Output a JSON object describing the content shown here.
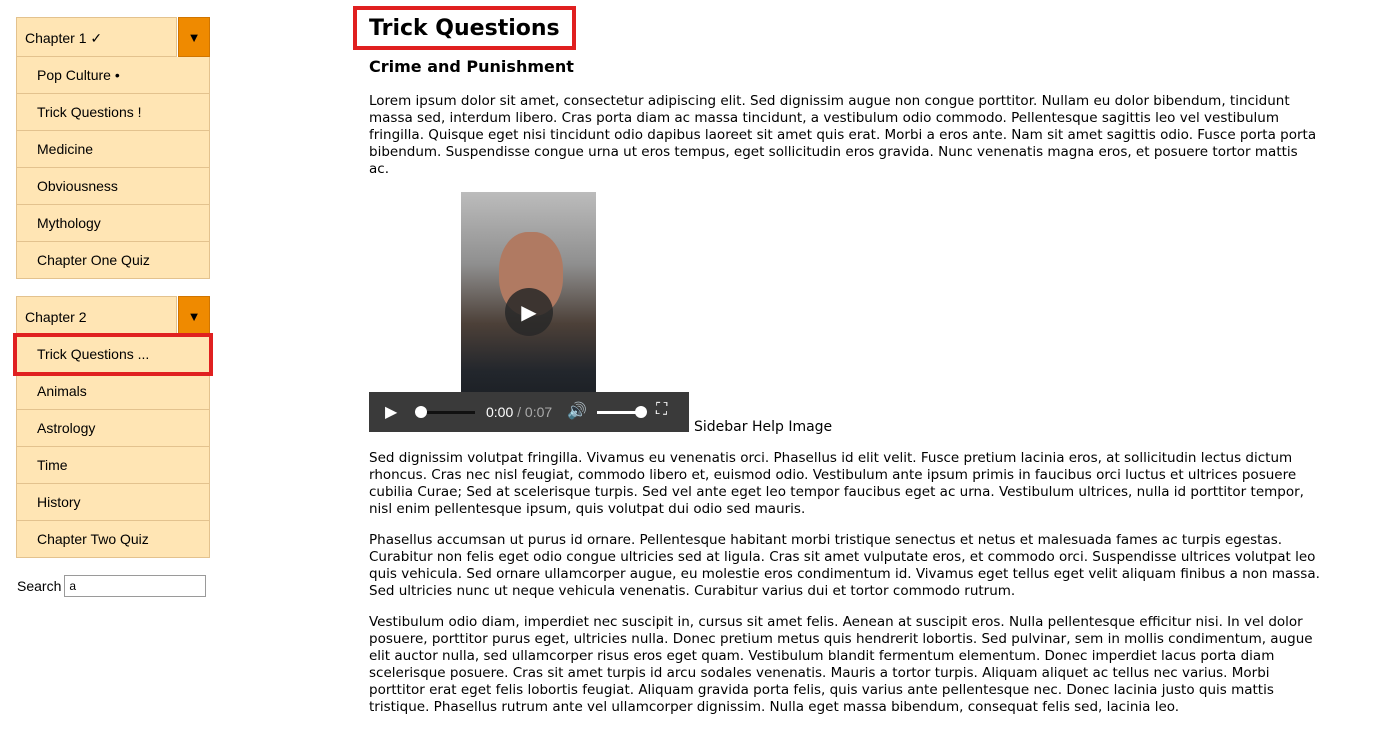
{
  "sidebar": {
    "chapters": [
      {
        "title": "Chapter 1 ✓",
        "toggle": "▼",
        "items": [
          "Pop Culture •",
          "Trick Questions !",
          "Medicine",
          "Obviousness",
          "Mythology",
          "Chapter One Quiz"
        ]
      },
      {
        "title": "Chapter 2",
        "toggle": "▼",
        "items": [
          "Trick Questions ...",
          "Animals",
          "Astrology",
          "Time",
          "History",
          "Chapter Two Quiz"
        ]
      }
    ],
    "search": {
      "label": "Search",
      "value": "a"
    }
  },
  "main": {
    "title": "Trick Questions",
    "subtitle": "Crime and Punishment",
    "paragraph1": "Lorem ipsum dolor sit amet, consectetur adipiscing elit. Sed dignissim augue non congue porttitor. Nullam eu dolor bibendum, tincidunt massa sed, interdum libero. Cras porta diam ac massa tincidunt, a vestibulum odio commodo. Pellentesque sagittis leo vel vestibulum fringilla. Quisque eget nisi tincidunt odio dapibus laoreet sit amet quis erat. Morbi a eros ante. Nam sit amet sagittis odio. Fusce porta porta bibendum. Suspendisse congue urna ut eros tempus, eget sollicitudin eros gravida. Nunc venenatis magna eros, et posuere tortor mattis ac.",
    "video": {
      "current_time": "0:00",
      "duration": "/ 0:07",
      "progress": 0,
      "volume": 1.0,
      "play_icon": "▶",
      "volume_icon": "🔊",
      "fullscreen_icon": "⛶"
    },
    "image_alt": "Sidebar Help Image",
    "paragraph2": "Sed dignissim volutpat fringilla. Vivamus eu venenatis orci. Phasellus id elit velit. Fusce pretium lacinia eros, at sollicitudin lectus dictum rhoncus. Cras nec nisl feugiat, commodo libero et, euismod odio. Vestibulum ante ipsum primis in faucibus orci luctus et ultrices posuere cubilia Curae; Sed at scelerisque turpis. Sed vel ante eget leo tempor faucibus eget ac urna. Vestibulum ultrices, nulla id porttitor tempor, nisl enim pellentesque ipsum, quis volutpat dui odio sed mauris.",
    "paragraph3": "Phasellus accumsan ut purus id ornare. Pellentesque habitant morbi tristique senectus et netus et malesuada fames ac turpis egestas. Curabitur non felis eget odio congue ultricies sed at ligula. Cras sit amet vulputate eros, et commodo orci. Suspendisse ultrices volutpat leo quis vehicula. Sed ornare ullamcorper augue, eu molestie eros condimentum id. Vivamus eget tellus eget velit aliquam finibus a non massa. Sed ultricies nunc ut neque vehicula venenatis. Curabitur varius dui et tortor commodo rutrum.",
    "paragraph4": "Vestibulum odio diam, imperdiet nec suscipit in, cursus sit amet felis. Aenean at suscipit eros. Nulla pellentesque efficitur nisi. In vel dolor posuere, porttitor purus eget, ultricies nulla. Donec pretium metus quis hendrerit lobortis. Sed pulvinar, sem in mollis condimentum, augue elit auctor nulla, sed ullamcorper risus eros eget quam. Vestibulum blandit fermentum elementum. Donec imperdiet lacus porta diam scelerisque posuere. Cras sit amet turpis id arcu sodales venenatis. Mauris a tortor turpis. Aliquam aliquet ac tellus nec varius. Morbi porttitor erat eget felis lobortis feugiat. Aliquam gravida porta felis, quis varius ante pellentesque nec. Donec lacinia justo quis mattis tristique. Phasellus rutrum ante vel ullamcorper dignissim. Nulla eget massa bibendum, consequat felis sed, lacinia leo."
  },
  "colors": {
    "menu_bg": "#ffe5b4",
    "toggle_bg": "#ef8a00",
    "highlight": "#e02020"
  }
}
